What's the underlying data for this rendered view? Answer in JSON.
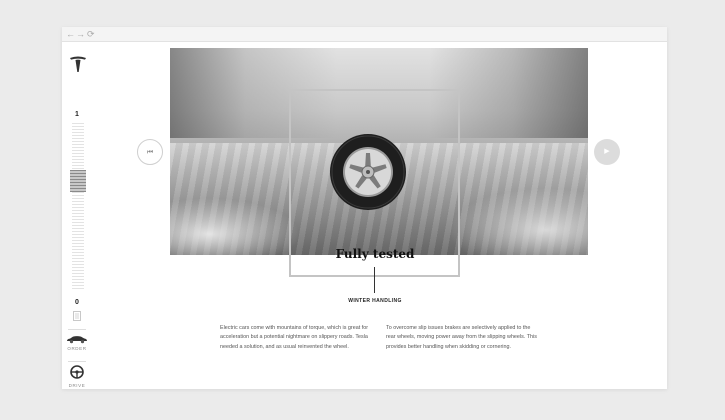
{
  "browser": {
    "back_glyph": "←",
    "forward_glyph": "→",
    "refresh_glyph": "⟳"
  },
  "sidebar": {
    "logo_icon": "tesla-logo-icon",
    "step_top": "1",
    "step_bottom": "0",
    "scroll_progress": 0.32,
    "order_label": "ORDER",
    "drive_label": "DRIVE",
    "order_icon": "car-icon",
    "drive_icon": "steering-wheel-icon"
  },
  "slide": {
    "prev_icon": "prev-icon",
    "prev_glyph": "⏮",
    "next_icon": "play-icon",
    "next_glyph": "▶",
    "headline": "Fully tested",
    "subtitle": "WINTER HANDLING"
  },
  "content": {
    "left_paragraph": "Electric cars come with mountains of torque, which is great for acceleration but a potential nightmare on slippery roads. Tesla needed a solution, and as usual reinvented the wheel.",
    "right_paragraph": "To overcome slip issues brakes are selectively applied to the rear wheels, moving power away from the slipping wheels. This provides better handling when skidding or cornering."
  },
  "colors": {
    "page_background": "#ebebeb",
    "window_background": "#ffffff",
    "frame_border": "#c4c4c4",
    "text_dark": "#111111",
    "text_body": "#555555"
  }
}
